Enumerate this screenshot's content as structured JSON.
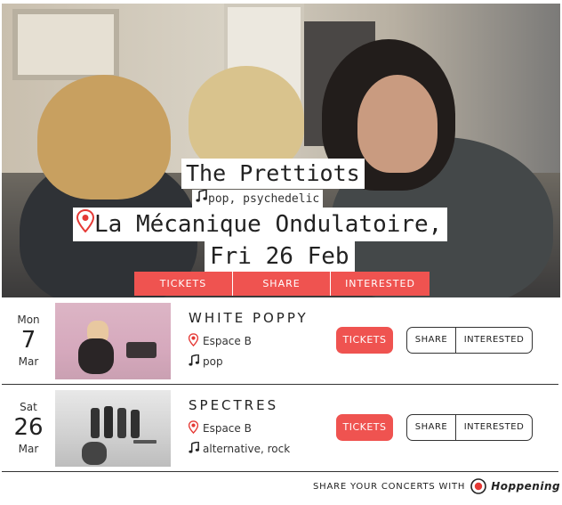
{
  "featured": {
    "artist": "The Prettiots",
    "genres": "pop, psychedelic",
    "venue": "La Mécanique Ondulatoire,",
    "date": "Fri 26 Feb",
    "tickets_label": "TICKETS",
    "share_label": "SHARE",
    "interested_label": "INTERESTED"
  },
  "events": [
    {
      "dow": "Mon",
      "day": "7",
      "month": "Mar",
      "artist": "WHITE POPPY",
      "venue": "Espace B",
      "genres": "pop",
      "tickets_label": "TICKETS",
      "share_label": "SHARE",
      "interested_label": "INTERESTED"
    },
    {
      "dow": "Sat",
      "day": "26",
      "month": "Mar",
      "artist": "SPECTRES",
      "venue": "Espace B",
      "genres": "alternative, rock",
      "tickets_label": "TICKETS",
      "share_label": "SHARE",
      "interested_label": "INTERESTED"
    }
  ],
  "footer": {
    "text": "SHARE YOUR CONCERTS WITH",
    "brand": "Hoppening"
  },
  "colors": {
    "accent": "#ef5350",
    "text": "#222222"
  },
  "icons": [
    "location-pin-icon",
    "music-note-icon",
    "hoppening-logo-icon"
  ]
}
